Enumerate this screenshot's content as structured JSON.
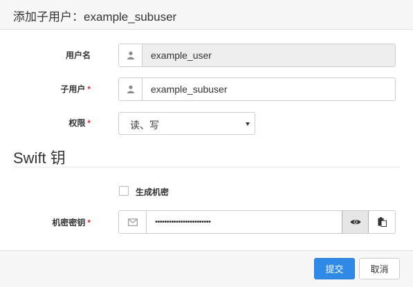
{
  "modal": {
    "title": "添加子用户：example_subuser"
  },
  "form": {
    "user": {
      "label": "用户名",
      "value": "example_user",
      "icon": "user-icon"
    },
    "subuser": {
      "label": "子用户",
      "value": "example_subuser",
      "icon": "user-icon"
    },
    "permission": {
      "label": "权限",
      "selected": "读、写",
      "icon": "chevron-down-icon"
    },
    "required_mark": "*"
  },
  "swift_section": {
    "title": "Swift 钥",
    "generate_key_label": "生成机密",
    "generate_key_checked": false,
    "secret_key": {
      "label": "机密密钥",
      "masked_value": "••••••••••••••••••••••••",
      "icon": "envelope-icon"
    }
  },
  "footer": {
    "submit_label": "提交",
    "cancel_label": "取消"
  },
  "colors": {
    "primary": "#2e8ae6",
    "required": "#c9302c",
    "header_bg": "#f7f7f7"
  }
}
